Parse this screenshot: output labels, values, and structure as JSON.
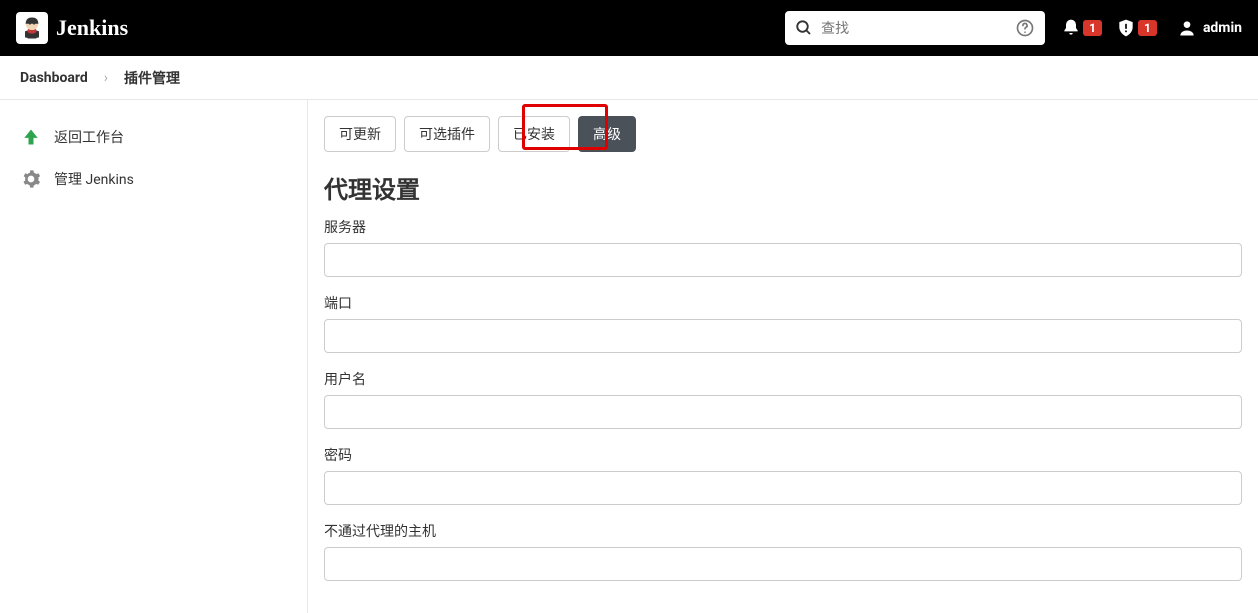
{
  "header": {
    "brand": "Jenkins",
    "search_placeholder": "查找",
    "notifications_count": "1",
    "alerts_count": "1",
    "username": "admin"
  },
  "breadcrumb": {
    "items": [
      "Dashboard",
      "插件管理"
    ]
  },
  "sidebar": {
    "items": [
      {
        "label": "返回工作台",
        "icon": "up-arrow"
      },
      {
        "label": "管理 Jenkins",
        "icon": "gear"
      }
    ]
  },
  "main": {
    "tabs": [
      {
        "label": "可更新",
        "active": false
      },
      {
        "label": "可选插件",
        "active": false
      },
      {
        "label": "已安装",
        "active": false
      },
      {
        "label": "高级",
        "active": true
      }
    ],
    "section_title": "代理设置",
    "fields": [
      {
        "label": "服务器",
        "value": ""
      },
      {
        "label": "端口",
        "value": ""
      },
      {
        "label": "用户名",
        "value": ""
      },
      {
        "label": "密码",
        "value": ""
      },
      {
        "label": "不通过代理的主机",
        "value": ""
      }
    ]
  }
}
